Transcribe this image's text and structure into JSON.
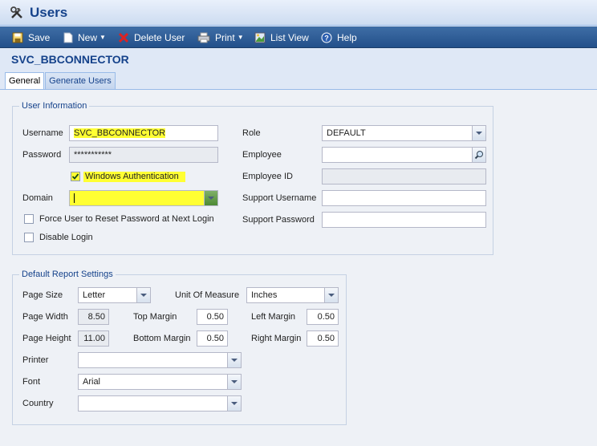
{
  "window": {
    "title": "Users"
  },
  "toolbar": {
    "save": "Save",
    "new": "New",
    "delete_user": "Delete User",
    "print": "Print",
    "list_view": "List View",
    "help": "Help"
  },
  "record_title": "SVC_BBCONNECTOR",
  "tabs": [
    {
      "label": "General",
      "active": true
    },
    {
      "label": "Generate Users",
      "active": false
    }
  ],
  "user_info": {
    "legend": "User Information",
    "username_label": "Username",
    "username_value": "SVC_BBCONNECTOR",
    "password_label": "Password",
    "password_value": "***********",
    "windows_auth_label": "Windows Authentication",
    "windows_auth_checked": true,
    "domain_label": "Domain",
    "domain_value": "",
    "force_reset_label": "Force User to Reset Password at Next Login",
    "disable_login_label": "Disable Login",
    "role_label": "Role",
    "role_value": "DEFAULT",
    "employee_label": "Employee",
    "employee_value": "",
    "employee_id_label": "Employee ID",
    "employee_id_value": "",
    "support_username_label": "Support Username",
    "support_username_value": "",
    "support_password_label": "Support Password",
    "support_password_value": ""
  },
  "report_settings": {
    "legend": "Default Report Settings",
    "page_size_label": "Page Size",
    "page_size_value": "Letter",
    "unit_label": "Unit Of Measure",
    "unit_value": "Inches",
    "page_width_label": "Page Width",
    "page_width_value": "8.50",
    "page_height_label": "Page Height",
    "page_height_value": "11.00",
    "top_margin_label": "Top Margin",
    "top_margin_value": "0.50",
    "bottom_margin_label": "Bottom Margin",
    "bottom_margin_value": "0.50",
    "left_margin_label": "Left Margin",
    "left_margin_value": "0.50",
    "right_margin_label": "Right Margin",
    "right_margin_value": "0.50",
    "printer_label": "Printer",
    "printer_value": "",
    "font_label": "Font",
    "font_value": "Arial",
    "country_label": "Country",
    "country_value": ""
  },
  "colors": {
    "highlight": "#ffff33",
    "toolbar": "#2e5c96",
    "title": "#15428b"
  }
}
